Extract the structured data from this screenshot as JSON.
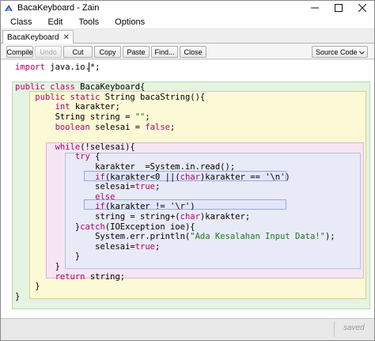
{
  "window": {
    "title": "BacaKeyboard - Zain"
  },
  "menu": [
    {
      "label": "Class"
    },
    {
      "label": "Edit"
    },
    {
      "label": "Tools"
    },
    {
      "label": "Options"
    }
  ],
  "tabs": [
    {
      "label": "BacaKeyboard",
      "close": "✕"
    }
  ],
  "toolbar": {
    "buttons": [
      {
        "label": "Compile",
        "enabled": true
      },
      {
        "label": "Undo",
        "enabled": false
      },
      {
        "label": "Cut",
        "enabled": true
      },
      {
        "label": "Copy",
        "enabled": true
      },
      {
        "label": "Paste",
        "enabled": true
      },
      {
        "label": "Find...",
        "enabled": true
      },
      {
        "label": "Close",
        "enabled": true
      }
    ],
    "view_select": "Source Code"
  },
  "colors": {
    "keyword": "#b8006b",
    "string": "#1c7a1c",
    "class_scope": "#e5f4e0",
    "method_scope": "#fbf9d6",
    "loop_scope": "#f6e6f4",
    "try_scope": "#e9eaf7",
    "if_scope": "#e3e6fa"
  },
  "code": [
    [
      {
        "t": "import",
        "k": "kw"
      },
      {
        "t": " java.io.*;"
      }
    ],
    [],
    [
      {
        "t": "public class",
        "k": "kw"
      },
      {
        "t": " BacaKeyboard{"
      }
    ],
    [
      {
        "t": "    "
      },
      {
        "t": "public static",
        "k": "kw"
      },
      {
        "t": " String bacaString(){"
      }
    ],
    [
      {
        "t": "        "
      },
      {
        "t": "int",
        "k": "kw"
      },
      {
        "t": " karakter;"
      }
    ],
    [
      {
        "t": "        String string = "
      },
      {
        "t": "\"\"",
        "k": "str"
      },
      {
        "t": ";"
      }
    ],
    [
      {
        "t": "        "
      },
      {
        "t": "boolean",
        "k": "kw"
      },
      {
        "t": " selesai = "
      },
      {
        "t": "false",
        "k": "kw"
      },
      {
        "t": ";"
      }
    ],
    [],
    [
      {
        "t": "        "
      },
      {
        "t": "while",
        "k": "kw"
      },
      {
        "t": "(!selesai){"
      }
    ],
    [
      {
        "t": "            "
      },
      {
        "t": "try",
        "k": "kw"
      },
      {
        "t": " {"
      }
    ],
    [
      {
        "t": "                karakter  =System.in.read();"
      }
    ],
    [
      {
        "t": "                "
      },
      {
        "t": "if",
        "k": "kw"
      },
      {
        "t": "(karakter<0 ||("
      },
      {
        "t": "char",
        "k": "kw"
      },
      {
        "t": ")karakter == '\\n')"
      }
    ],
    [
      {
        "t": "                selesai="
      },
      {
        "t": "true",
        "k": "kw"
      },
      {
        "t": ";"
      }
    ],
    [
      {
        "t": "                "
      },
      {
        "t": "else",
        "k": "kw"
      }
    ],
    [
      {
        "t": "                "
      },
      {
        "t": "if",
        "k": "kw"
      },
      {
        "t": "(karakter != '\\r')"
      }
    ],
    [
      {
        "t": "                string = string+("
      },
      {
        "t": "char",
        "k": "kw"
      },
      {
        "t": ")karakter;"
      }
    ],
    [
      {
        "t": "            }"
      },
      {
        "t": "catch",
        "k": "kw"
      },
      {
        "t": "(IOException ioe){"
      }
    ],
    [
      {
        "t": "                System.err.println("
      },
      {
        "t": "\"Ada Kesalahan Input Data!\"",
        "k": "str"
      },
      {
        "t": ");"
      }
    ],
    [
      {
        "t": "                selesai="
      },
      {
        "t": "true",
        "k": "kw"
      },
      {
        "t": ";"
      }
    ],
    [
      {
        "t": "            }"
      }
    ],
    [
      {
        "t": "        }"
      }
    ],
    [
      {
        "t": "        "
      },
      {
        "t": "return",
        "k": "kw"
      },
      {
        "t": " string;"
      }
    ],
    [
      {
        "t": "    }"
      }
    ],
    [
      {
        "t": "}"
      }
    ]
  ],
  "status": {
    "saved": "saved"
  }
}
